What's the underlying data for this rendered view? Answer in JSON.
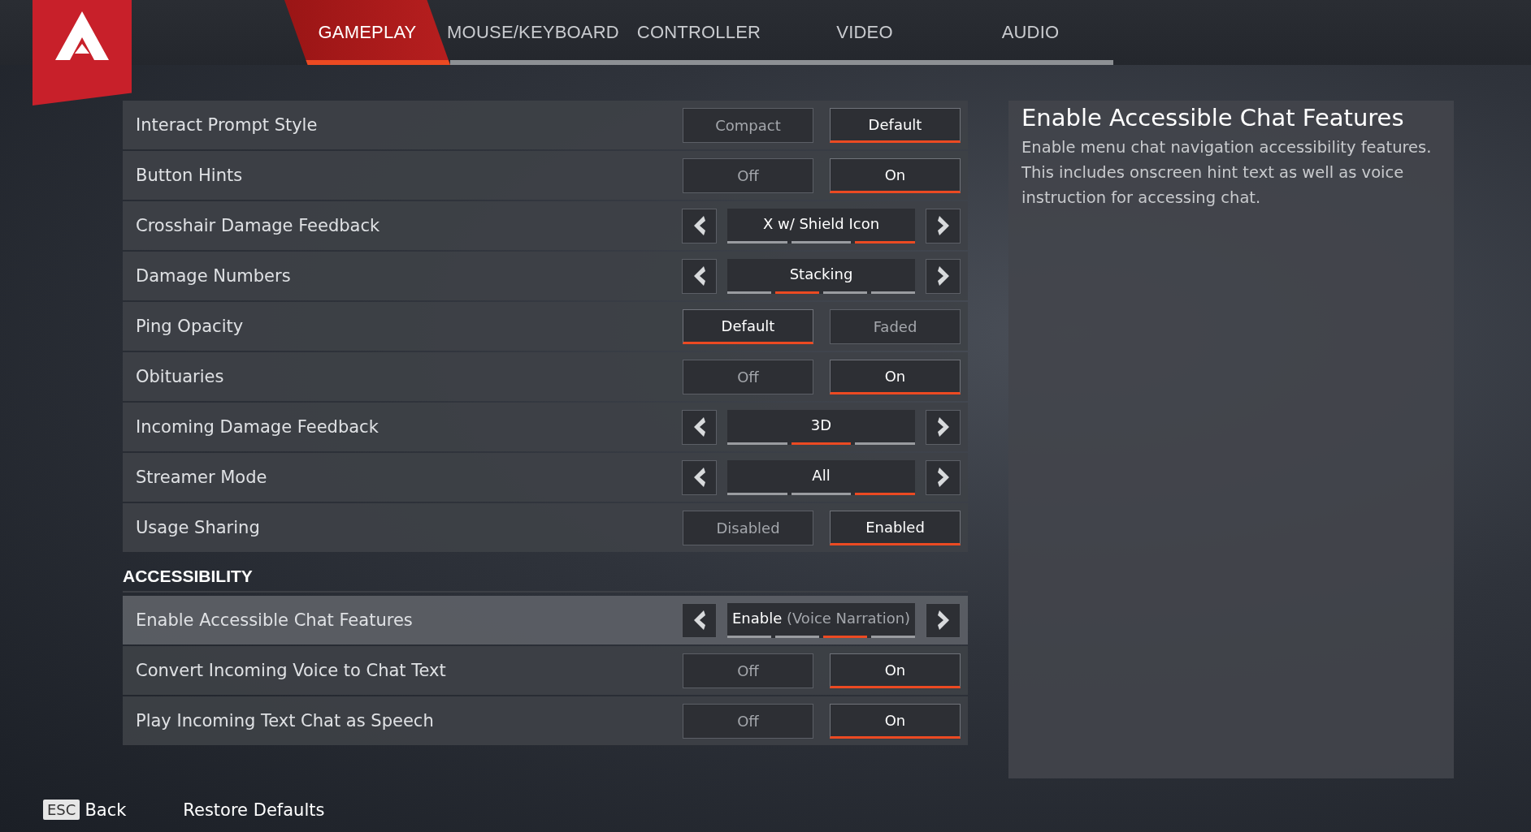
{
  "tabs": [
    {
      "label": "GAMEPLAY",
      "selected": true
    },
    {
      "label": "MOUSE/KEYBOARD",
      "selected": false
    },
    {
      "label": "CONTROLLER",
      "selected": false
    },
    {
      "label": "VIDEO",
      "selected": false
    },
    {
      "label": "AUDIO",
      "selected": false
    }
  ],
  "settings": [
    {
      "kind": "toggle",
      "label": "Interact Prompt Style",
      "focused": false,
      "options": [
        {
          "label": "Compact",
          "selected": false
        },
        {
          "label": "Default",
          "selected": true
        }
      ]
    },
    {
      "kind": "toggle",
      "label": "Button Hints",
      "focused": false,
      "options": [
        {
          "label": "Off",
          "selected": false
        },
        {
          "label": "On",
          "selected": true
        }
      ]
    },
    {
      "kind": "cycle",
      "label": "Crosshair Damage Feedback",
      "focused": false,
      "value": "X w/ Shield Icon",
      "segments": [
        {
          "selected": false
        },
        {
          "selected": false
        },
        {
          "selected": true
        }
      ]
    },
    {
      "kind": "cycle",
      "label": "Damage Numbers",
      "focused": false,
      "value": "Stacking",
      "segments": [
        {
          "selected": false
        },
        {
          "selected": true
        },
        {
          "selected": false
        },
        {
          "selected": false
        }
      ]
    },
    {
      "kind": "toggle",
      "label": "Ping Opacity",
      "focused": false,
      "options": [
        {
          "label": "Default",
          "selected": true
        },
        {
          "label": "Faded",
          "selected": false
        }
      ]
    },
    {
      "kind": "toggle",
      "label": "Obituaries",
      "focused": false,
      "options": [
        {
          "label": "Off",
          "selected": false
        },
        {
          "label": "On",
          "selected": true
        }
      ]
    },
    {
      "kind": "cycle",
      "label": "Incoming Damage Feedback",
      "focused": false,
      "value": "3D",
      "segments": [
        {
          "selected": false
        },
        {
          "selected": true
        },
        {
          "selected": false
        }
      ]
    },
    {
      "kind": "cycle",
      "label": "Streamer Mode",
      "focused": false,
      "value": "All",
      "segments": [
        {
          "selected": false
        },
        {
          "selected": false
        },
        {
          "selected": true
        }
      ]
    },
    {
      "kind": "toggle",
      "label": "Usage Sharing",
      "focused": false,
      "options": [
        {
          "label": "Disabled",
          "selected": false
        },
        {
          "label": "Enabled",
          "selected": true
        }
      ]
    }
  ],
  "accessibility": {
    "heading": "ACCESSIBILITY",
    "settings": [
      {
        "kind": "cycle",
        "label": "Enable Accessible Chat Features",
        "focused": true,
        "value": "Enable",
        "value_note": "(Voice Narration)",
        "segments": [
          {
            "selected": false
          },
          {
            "selected": false
          },
          {
            "selected": true
          },
          {
            "selected": false
          }
        ]
      },
      {
        "kind": "toggle",
        "label": "Convert Incoming Voice to Chat Text",
        "focused": false,
        "options": [
          {
            "label": "Off",
            "selected": false
          },
          {
            "label": "On",
            "selected": true
          }
        ]
      },
      {
        "kind": "toggle",
        "label": "Play Incoming Text Chat as Speech",
        "focused": false,
        "options": [
          {
            "label": "Off",
            "selected": false
          },
          {
            "label": "On",
            "selected": true
          }
        ]
      }
    ]
  },
  "description": {
    "title": "Enable Accessible Chat Features",
    "text": "Enable menu chat navigation accessibility features. This includes onscreen hint text as well as voice instruction for accessing chat."
  },
  "footer": {
    "back_key": "ESC",
    "back_label": "Back",
    "restore": "Restore Defaults"
  }
}
